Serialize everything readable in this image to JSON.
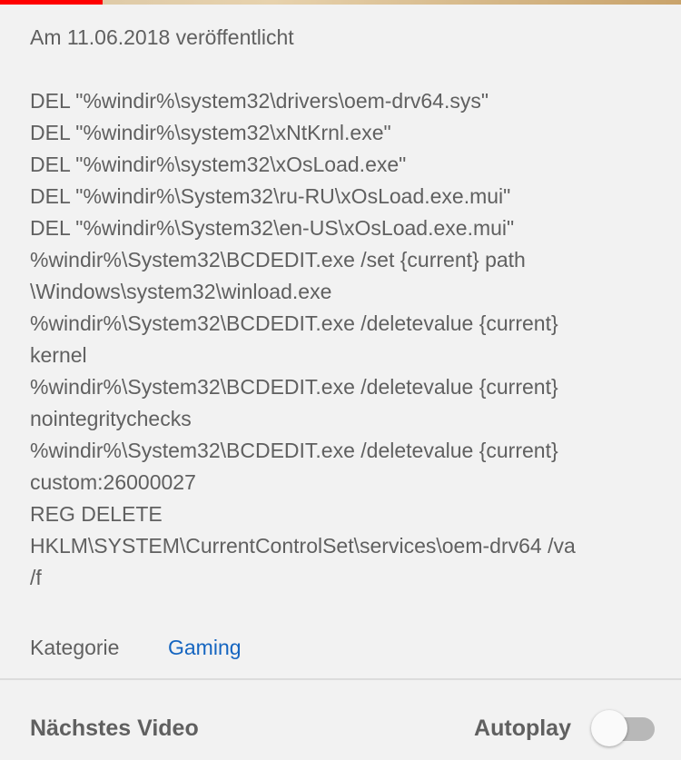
{
  "video": {
    "playback_progress_percent": 15
  },
  "published": "Am 11.06.2018 veröffentlicht",
  "description_lines": [
    "DEL \"%windir%\\system32\\drivers\\oem-drv64.sys\"",
    "DEL \"%windir%\\system32\\xNtKrnl.exe\"",
    "DEL \"%windir%\\system32\\xOsLoad.exe\"",
    "DEL \"%windir%\\System32\\ru-RU\\xOsLoad.exe.mui\"",
    "DEL \"%windir%\\System32\\en-US\\xOsLoad.exe.mui\"",
    "%windir%\\System32\\BCDEDIT.exe /set {current} path",
    "\\Windows\\system32\\winload.exe",
    "%windir%\\System32\\BCDEDIT.exe /deletevalue {current}",
    "kernel",
    "%windir%\\System32\\BCDEDIT.exe /deletevalue {current}",
    "nointegritychecks",
    "%windir%\\System32\\BCDEDIT.exe /deletevalue {current}",
    "custom:26000027",
    "REG DELETE",
    "HKLM\\SYSTEM\\CurrentControlSet\\services\\oem-drv64 /va",
    "/f"
  ],
  "category": {
    "label": "Kategorie",
    "value": "Gaming"
  },
  "next": {
    "title": "Nächstes Video",
    "autoplay_label": "Autoplay",
    "autoplay_on": false
  }
}
